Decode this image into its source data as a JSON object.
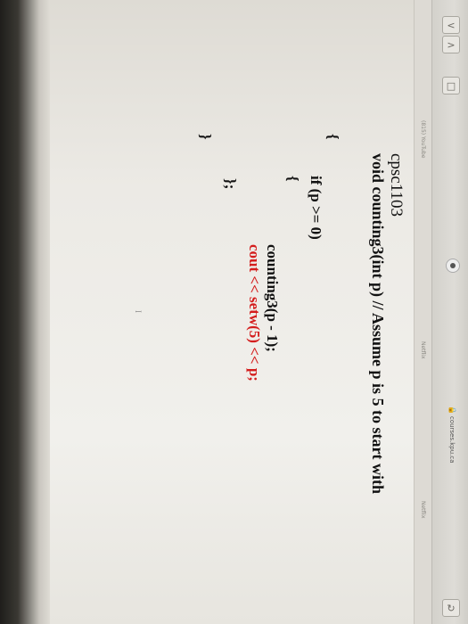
{
  "browser": {
    "url": "courses.kpu.ca",
    "tab_left": "(815) YouTube",
    "tab_mid": "Netflix",
    "tab_right": "Netflix",
    "nav_back": "<",
    "nav_forward": ">",
    "sidebar_icon": "sidebar-icon",
    "reload_icon": "reload-icon"
  },
  "code": {
    "course": "cpsc1103",
    "signature": "void counting3(int p) // Assume p is 5 to start with",
    "open_brace_outer": "{",
    "if_line": "if (p >= 0)",
    "open_brace_inner": "{",
    "recursive_call": "counting3(p - 1);",
    "output_line": "cout << setw(5) << p;",
    "close_brace_inner": "};",
    "close_brace_outer": "}"
  },
  "colors": {
    "text": "#111111",
    "highlight": "#d41d1d",
    "page_background": "#f1f0ec"
  }
}
